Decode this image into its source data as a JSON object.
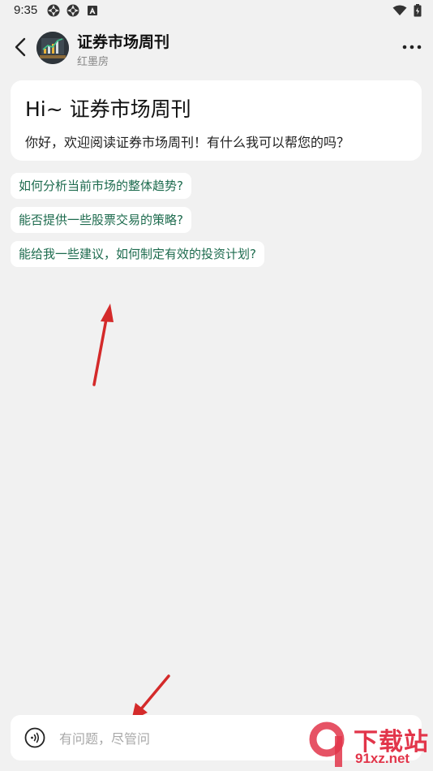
{
  "status_bar": {
    "time": "9:35"
  },
  "header": {
    "title": "证券市场周刊",
    "subtitle": "红墨房"
  },
  "welcome": {
    "title": "Hi~ 证券市场周刊",
    "text": "你好，欢迎阅读证券市场周刊！有什么我可以帮您的吗？"
  },
  "suggestions": [
    "如何分析当前市场的整体趋势?",
    "能否提供一些股票交易的策略?",
    "能给我一些建议，如何制定有效的投资计划?"
  ],
  "input": {
    "placeholder": "有问题，尽管问"
  },
  "watermark": {
    "text": "下载站",
    "url": "91xz.net"
  },
  "colors": {
    "accent_green": "#1d6b4e",
    "annotation_red": "#d42a2a",
    "watermark_red": "#e2354a"
  }
}
